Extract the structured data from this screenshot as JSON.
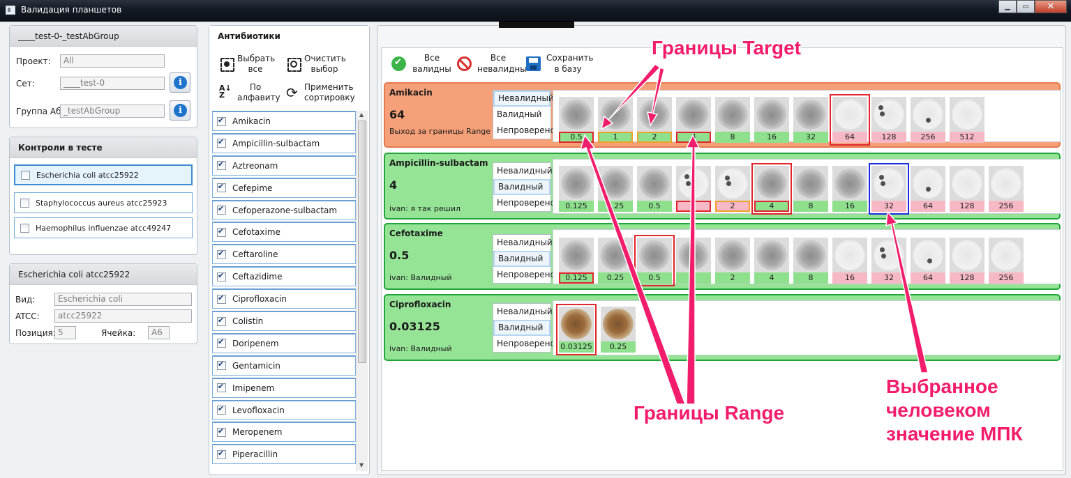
{
  "window": {
    "title": "Валидация планшетов"
  },
  "project_panel": {
    "title": "____test-0-_testAbGroup",
    "project_label": "Проект:",
    "project_value": "All",
    "set_label": "Сет:",
    "set_value": "____test-0",
    "group_label": "Группа Аб:",
    "group_value": "_testAbGroup"
  },
  "controls_panel": {
    "title": "Контроли в тесте",
    "items": [
      "Escherichia coli atcc25922",
      "Staphylococcus aureus atcc25923",
      "Haemophilus influenzae atcc49247"
    ]
  },
  "organism_panel": {
    "title": "Escherichia coli atcc25922",
    "species_label": "Вид:",
    "species_value": "Escherichia coli",
    "atcc_label": "ATCC:",
    "atcc_value": "atcc25922",
    "position_label": "Позиция:",
    "position_value": "5",
    "cell_label": "Ячейка:",
    "cell_value": "A6"
  },
  "antibiotics_panel": {
    "title": "Антибиотики",
    "select_all": "Выбрать все",
    "clear_selection": "Очистить выбор",
    "sort_alpha": "По алфавиту",
    "apply_sort": "Применить сортировку",
    "items": [
      "Amikacin",
      "Ampicillin-sulbactam",
      "Aztreonam",
      "Cefepime",
      "Cefoperazone-sulbactam",
      "Cefotaxime",
      "Ceftaroline",
      "Ceftazidime",
      "Ciprofloxacin",
      "Colistin",
      "Doripenem",
      "Gentamicin",
      "Imipenem",
      "Levofloxacin",
      "Meropenem",
      "Piperacillin"
    ]
  },
  "toolbar": {
    "all_valid": "Все валидны",
    "all_invalid": "Все невалидны",
    "save": "Сохранить в базу"
  },
  "status_options": [
    "Невалидный",
    "Валидный",
    "Непроверено"
  ],
  "cards": [
    {
      "name": "Amikacin",
      "mic": "64",
      "note": "Выход за границы Range",
      "status": "Невалидный",
      "color": "#f5a078",
      "wells": [
        "0.5",
        "1",
        "2",
        "4",
        "8",
        "16",
        "32",
        "64",
        "128",
        "256",
        "512"
      ]
    },
    {
      "name": "Ampicillin-sulbactam",
      "mic": "4",
      "note": "ivan:  я так решил",
      "status": "Валидный",
      "color": "#95e496",
      "wells": [
        "0.125",
        "0.25",
        "0.5",
        "1",
        "2",
        "4",
        "8",
        "16",
        "32",
        "64",
        "128",
        "256"
      ]
    },
    {
      "name": "Cefotaxime",
      "mic": "0.5",
      "note": "ivan:  Валидный",
      "status": "Валидный",
      "color": "#95e496",
      "wells": [
        "0.125",
        "0.25",
        "0.5",
        "1",
        "2",
        "4",
        "8",
        "16",
        "32",
        "64",
        "128",
        "256"
      ]
    },
    {
      "name": "Ciprofloxacin",
      "mic": "0.03125",
      "note": "ivan:  Валидный",
      "status": "Валидный",
      "color": "#95e496",
      "wells": [
        "0.03125",
        "0.25"
      ]
    }
  ],
  "annotations": {
    "target": "Границы Target",
    "range": "Границы Range",
    "human_line1": "Выбранное",
    "human_line2": "человеком",
    "human_line3": "значение МПК"
  }
}
